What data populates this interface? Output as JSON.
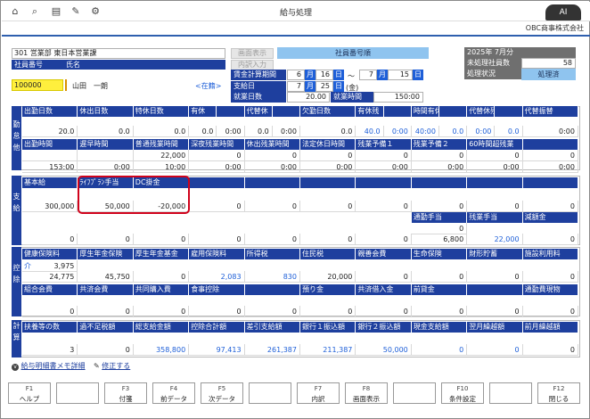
{
  "window": {
    "title": "給与処理",
    "company": "OBC商事株式会社"
  },
  "toolbar": {
    "icons": [
      "home-icon",
      "search-icon",
      "print-icon",
      "pen-clear-icon",
      "settings-icon"
    ]
  },
  "header": {
    "department": "301 営業部 東日本営業課",
    "col_id": "社員番号",
    "col_name": "氏名",
    "employee_id": "100000",
    "employee_name": "山田　一朗",
    "status_link": "<在籍>",
    "btn_prev": "画面表示",
    "btn_input": "内訳入力",
    "sort_label": "社員番号順",
    "calc_label": "賃金計算期間",
    "pay_label": "支給日",
    "workdays_label": "就業日数",
    "workhours_label": "就業時間",
    "calc_from_month": "6",
    "calc_from_day": "16",
    "calc_to_month": "7",
    "calc_to_day": "15",
    "pay_month": "7",
    "pay_day": "25",
    "pay_weekday": "(金)",
    "u_month": "月",
    "u_day": "日",
    "u_tilde": "～",
    "workdays": "20.00",
    "workhours": "150:00",
    "period": "2025年 7月分",
    "unprocessed_label": "未処理社員数",
    "unprocessed": "58",
    "state_label": "処理状況",
    "state": "処理済"
  },
  "attendance": {
    "side": "勤怠他",
    "row1_headers": [
      "出勤日数",
      "休出日数",
      "特休日数",
      "有休",
      "",
      "代替休",
      "",
      "欠勤日数",
      "有休残",
      "",
      "時間有休残",
      "",
      "代替休残",
      "",
      "代替振替"
    ],
    "row1_values": [
      "20.0",
      "0.0",
      "0.0",
      "0.0",
      "0:00",
      "0.0",
      "0:00",
      "0.0",
      "40.0",
      "0:00",
      "40:00",
      "0.0",
      "0:00",
      "0.0",
      "0:00"
    ],
    "row2_headers": [
      "出勤時間",
      "遅早時間",
      "普通残業時間",
      "深夜残業時間",
      "休出残業時間",
      "法定休日時間",
      "残業予備１",
      "残業予備２",
      "60時間超残業"
    ],
    "row2_top": [
      "",
      "",
      "22,000",
      "0",
      "0",
      "0",
      "0",
      "0",
      "0",
      "0"
    ],
    "row2_values": [
      "153:00",
      "0:00",
      "10:00",
      "0:00",
      "0:00",
      "0:00",
      "0:00",
      "0:00",
      "0:00",
      "0:00"
    ]
  },
  "payment": {
    "side": "支給",
    "headers": [
      "基本給",
      "ﾗｲﾌﾌﾟﾗﾝ手当",
      "DC掛金",
      "",
      "",
      "",
      "",
      "",
      "",
      ""
    ],
    "row1": [
      "300,000",
      "50,000",
      "-20,000",
      "0",
      "0",
      "0",
      "0",
      "0",
      "0",
      "0"
    ],
    "sub_headers": [
      "通勤手当",
      "残業手当",
      "減額金"
    ],
    "row2a": [
      "0"
    ],
    "row2": [
      "0",
      "0",
      "0",
      "0",
      "0",
      "0",
      "0",
      "6,800",
      "22,000",
      "0"
    ]
  },
  "deduction": {
    "side": "控除",
    "headers": [
      "健康保険料",
      "厚生年金保険",
      "厚生年金基金",
      "雇用保険料",
      "所得税",
      "住民税",
      "親善会費",
      "生命保険",
      "財形貯蓄",
      "施設利用料"
    ],
    "care_label": "介",
    "care_value": "3,975",
    "row1": [
      "24,775",
      "45,750",
      "0",
      "2,083",
      "830",
      "20,000",
      "0",
      "0",
      "0",
      "0"
    ],
    "headers2": [
      "組合会費",
      "共済会費",
      "共同購入費",
      "食事控除",
      "",
      "預り金",
      "共済借入金",
      "前貸金",
      "",
      "通勤費現物"
    ],
    "row2": [
      "0",
      "0",
      "0",
      "0",
      "0",
      "0",
      "0",
      "0",
      "0",
      "0"
    ]
  },
  "calc": {
    "side": "計算",
    "headers": [
      "扶養等の数",
      "過不足税額",
      "総支給金額",
      "控除合計額",
      "差引支給額",
      "銀行１振込額",
      "銀行２振込額",
      "現金支給額",
      "翌月繰越額",
      "前月繰越額"
    ],
    "row": [
      "3",
      "0",
      "358,800",
      "97,413",
      "261,387",
      "211,387",
      "50,000",
      "0",
      "0",
      "0"
    ]
  },
  "links": {
    "memo": "給与明細書メモ詳細",
    "edit": "修正する"
  },
  "fkeys": [
    {
      "key": "F1",
      "label": "ヘルプ"
    },
    {
      "key": "",
      "label": ""
    },
    {
      "key": "F3",
      "label": "付箋"
    },
    {
      "key": "F4",
      "label": "前データ"
    },
    {
      "key": "F5",
      "label": "次データ"
    },
    {
      "key": "",
      "label": ""
    },
    {
      "key": "F7",
      "label": "内訳"
    },
    {
      "key": "F8",
      "label": "画面表示"
    },
    {
      "key": "",
      "label": ""
    },
    {
      "key": "F10",
      "label": "条件設定"
    },
    {
      "key": "",
      "label": ""
    },
    {
      "key": "F12",
      "label": "閉じる"
    }
  ]
}
